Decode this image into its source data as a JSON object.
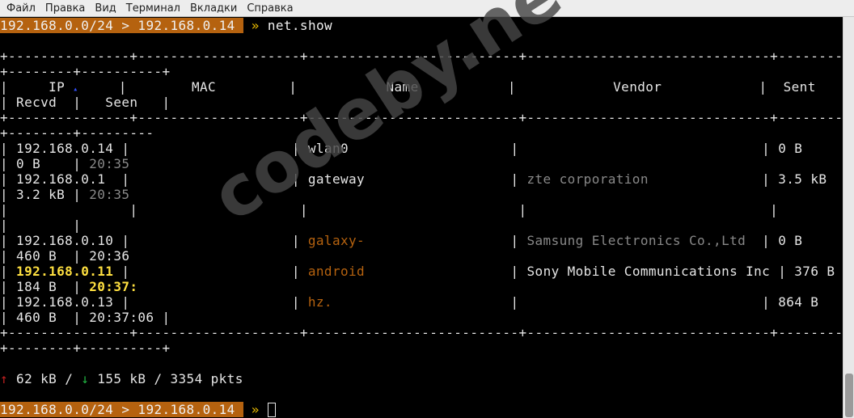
{
  "menu": [
    "Файл",
    "Правка",
    "Вид",
    "Терминал",
    "Вкладки",
    "Справка"
  ],
  "prompt": {
    "subnet": "192.168.0.0/24",
    "gt": ">",
    "host": "192.168.0.14",
    "symbol": "»",
    "command": "net.show"
  },
  "table": {
    "border_line_1": "+---------------+--------------------+--------------------------+------------------------------+--------",
    "border_line_2": "+--------+----------+",
    "header_line_1": [
      "|     IP ",
      "▴",
      "     |        MAC         |           Name           |            Vendor            |  Sent"
    ],
    "header_line_2": "| Recvd  |   Seen   |",
    "sep_line_1": "+---------------+--------------------+--------------------------+------------------------------+--------",
    "sep_line_2": "+--------+---------",
    "rows": [
      {
        "l1": [
          "| 192.168.0.14 |                    | ",
          "wlan0",
          "",
          "                    | ",
          "",
          "                             | 0 B"
        ],
        "l2": [
          "| 0 B    | ",
          "20:35"
        ]
      },
      {
        "l1": [
          "| 192.168.0.1  |                    | ",
          "gateway",
          "",
          "                  | ",
          "zte corporation",
          "              | 3.5 kB"
        ],
        "l2": [
          "| 3.2 kB | ",
          "20:35"
        ]
      },
      {
        "l1": [
          "|               |                    |                          |                              |",
          "",
          "",
          "",
          "",
          ""
        ],
        "l2": [
          "|        |",
          ""
        ]
      },
      {
        "l1": [
          "| 192.168.0.10 |                    | ",
          "galaxy-",
          "",
          "                  | ",
          "Samsung Electronics Co.,Ltd",
          "  | 0 B"
        ],
        "l2": [
          "| 460 B  | ",
          "20:36"
        ]
      },
      {
        "l1": [
          "| ",
          "192.168.0.11",
          " |                    | ",
          "android",
          "",
          "                  | Sony Mobile Communications Inc | 376 B"
        ],
        "l2": [
          "| 184 B  | ",
          "20:37:"
        ]
      },
      {
        "l1": [
          "| 192.168.0.13 |                    | ",
          "hz.",
          "",
          "                      |                              | 864 B"
        ],
        "l2": [
          "| 460 B  | ",
          "20:37:06 |"
        ]
      }
    ],
    "bottom_line_1": "+---------------+--------------------+--------------------------+------------------------------+--------",
    "bottom_line_2": "+--------+----------+"
  },
  "stats": {
    "up_arrow": "↑",
    "sent": " 62 kB / ",
    "down_arrow": "↓",
    "received_packets": " 155 kB / 3354 pkts"
  },
  "watermark": "codeby.net"
}
